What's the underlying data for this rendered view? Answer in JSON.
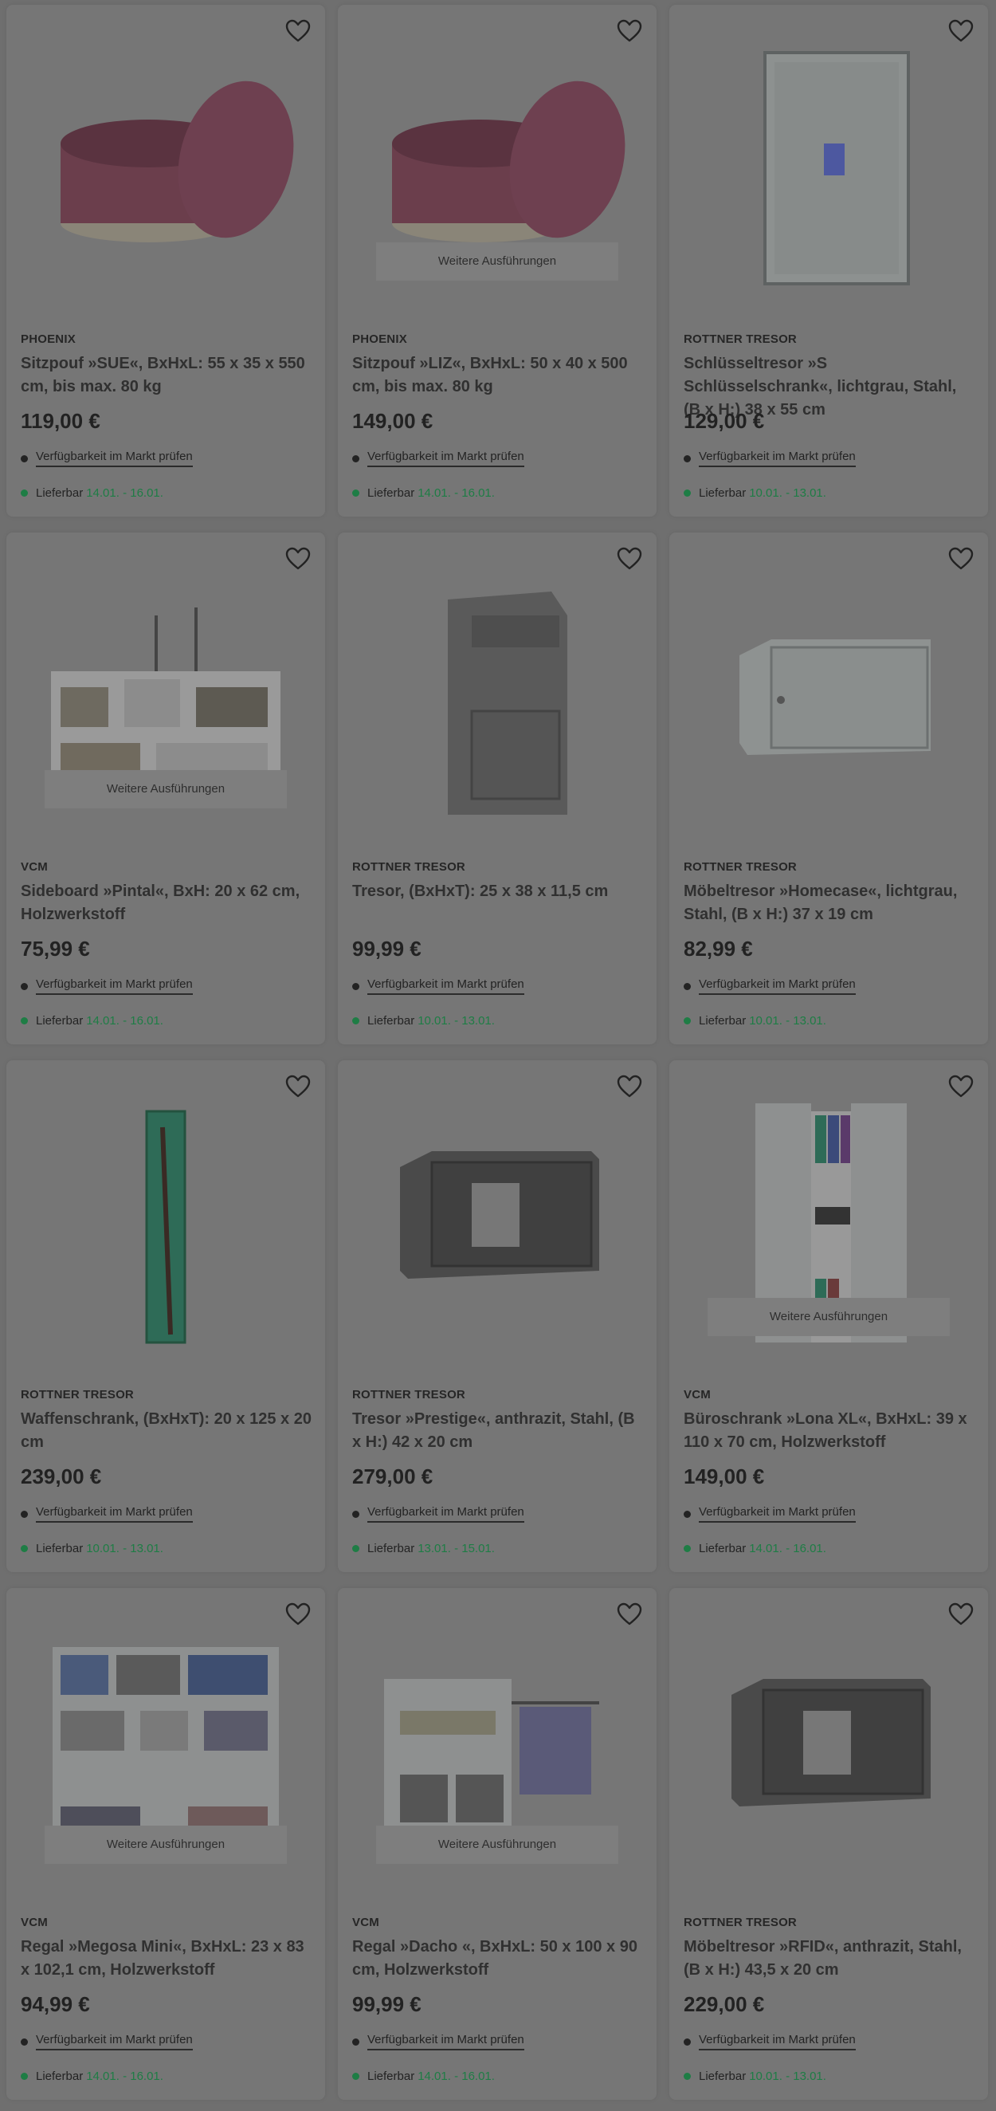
{
  "ui": {
    "variants_label": "Weitere Ausführungen",
    "check_label": "Verfügbarkeit im Markt prüfen",
    "delivery_label": "Lieferbar"
  },
  "products": [
    {
      "brand": "PHOENIX",
      "title": "Sitzpouf »SUE«, BxHxL: 55 x 35 x 550 cm, bis max. 80 kg",
      "price": "119,00 €",
      "delivery": "14.01. - 16.01.",
      "image_icon": "pouf-icon",
      "has_variants": false
    },
    {
      "brand": "PHOENIX",
      "title": "Sitzpouf »LIZ«, BxHxL: 50 x 40 x 500 cm, bis max. 80 kg",
      "price": "149,00 €",
      "delivery": "14.01. - 16.01.",
      "image_icon": "pouf-icon",
      "has_variants": true
    },
    {
      "brand": "ROTTNER TRESOR",
      "title": "Schlüsseltresor »S Schlüsselschrank«, lichtgrau, Stahl, (B x H:) 38 x 55 cm",
      "price": "129,00 €",
      "delivery": "10.01. - 13.01.",
      "image_icon": "key-cabinet-icon",
      "has_variants": false
    },
    {
      "brand": "VCM",
      "title": "Sideboard »Pintal«, BxH: 20 x 62 cm, Holzwerkstoff",
      "price": "75,99 €",
      "delivery": "14.01. - 16.01.",
      "image_icon": "shelf-icon",
      "has_variants": true
    },
    {
      "brand": "ROTTNER TRESOR",
      "title": "Tresor, (BxHxT): 25 x 38 x 11,5 cm",
      "price": "99,99 €",
      "delivery": "10.01. - 13.01.",
      "image_icon": "deposit-safe-icon",
      "has_variants": false
    },
    {
      "brand": "ROTTNER TRESOR",
      "title": "Möbeltresor »Homecase«, lichtgrau, Stahl, (B x H:) 37 x 19 cm",
      "price": "82,99 €",
      "delivery": "10.01. - 13.01.",
      "image_icon": "furniture-safe-icon",
      "has_variants": false
    },
    {
      "brand": "ROTTNER TRESOR",
      "title": "Waffenschrank, (BxHxT): 20 x 125 x 20 cm",
      "price": "239,00 €",
      "delivery": "10.01. - 13.01.",
      "image_icon": "gun-cabinet-icon",
      "has_variants": false
    },
    {
      "brand": "ROTTNER TRESOR",
      "title": "Tresor »Prestige«, anthrazit, Stahl, (B x H:) 42 x 20 cm",
      "price": "279,00 €",
      "delivery": "13.01. - 15.01.",
      "image_icon": "safe-icon",
      "has_variants": false
    },
    {
      "brand": "VCM",
      "title": "Büroschrank »Lona XL«, BxHxL: 39 x 110 x 70 cm, Holzwerkstoff",
      "price": "149,00 €",
      "delivery": "14.01. - 16.01.",
      "image_icon": "office-cabinet-icon",
      "has_variants": true
    },
    {
      "brand": "VCM",
      "title": "Regal »Megosa Mini«, BxHxL: 23 x 83 x 102,1 cm, Holzwerkstoff",
      "price": "94,99 €",
      "delivery": "14.01. - 16.01.",
      "image_icon": "bookshelf-icon",
      "has_variants": true
    },
    {
      "brand": "VCM",
      "title": "Regal »Dacho «, BxHxL: 50 x 100 x 90 cm, Holzwerkstoff",
      "price": "99,99 €",
      "delivery": "14.01. - 16.01.",
      "image_icon": "wardrobe-shelf-icon",
      "has_variants": true
    },
    {
      "brand": "ROTTNER TRESOR",
      "title": "Möbeltresor »RFID«, anthrazit, Stahl, (B x H:) 43,5 x 20 cm",
      "price": "229,00 €",
      "delivery": "10.01. - 13.01.",
      "image_icon": "safe-icon",
      "has_variants": false
    }
  ],
  "colors": {
    "overlay_background": "#6f6f6f",
    "card_background": "#767676",
    "delivery_green": "#1e7d45"
  }
}
